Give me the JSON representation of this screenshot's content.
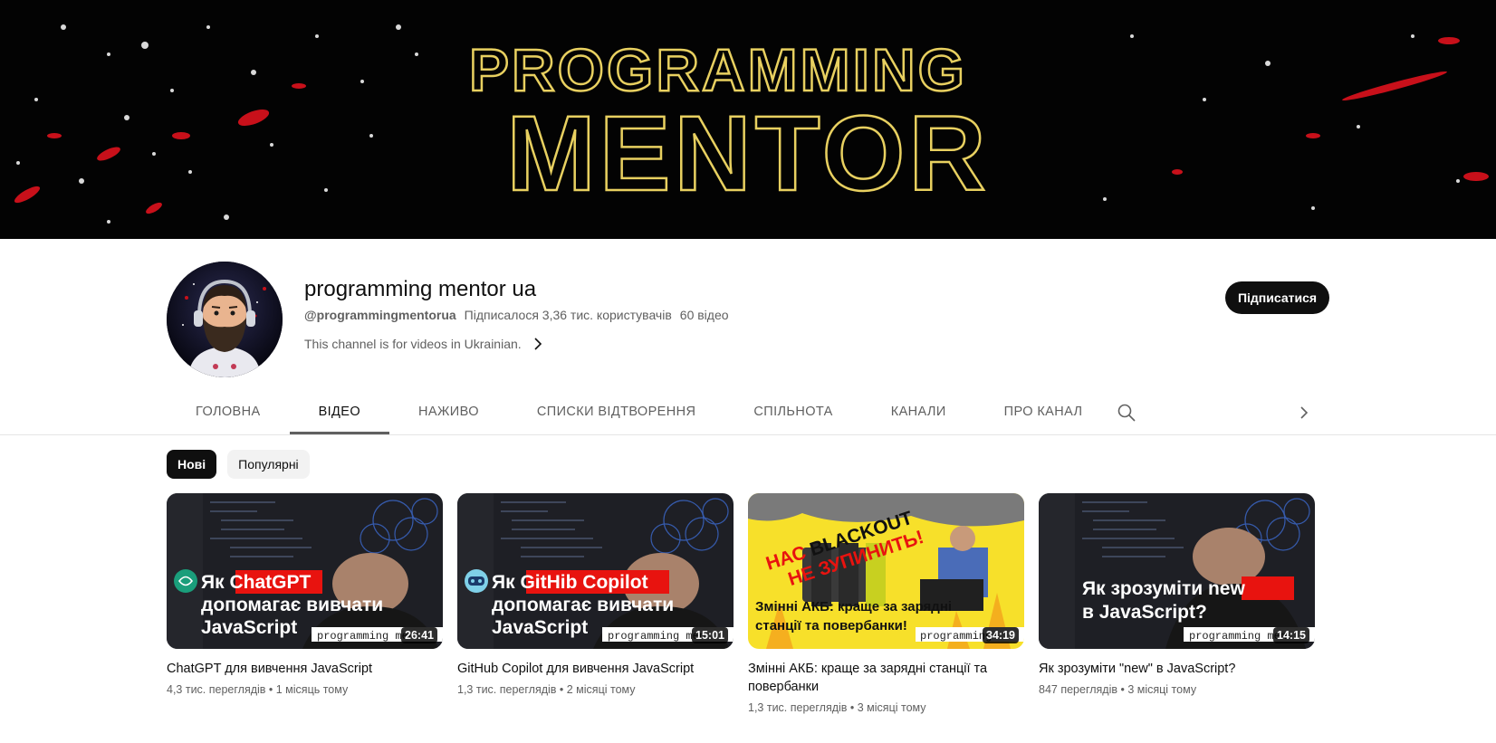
{
  "banner": {
    "line1": "PROGRAMMING",
    "line2": "MENTOR"
  },
  "channel": {
    "name": "programming mentor ua",
    "handle": "@programmingmentorua",
    "subscribers": "Підписалося 3,36 тис. користувачів",
    "video_count": "60 відео",
    "description": "This channel is for videos in Ukrainian.",
    "subscribe_label": "Підписатися"
  },
  "tabs": [
    {
      "label": "ГОЛОВНА"
    },
    {
      "label": "ВІДЕО"
    },
    {
      "label": "НАЖИВО"
    },
    {
      "label": "СПИСКИ ВІДТВОРЕННЯ"
    },
    {
      "label": "СПІЛЬНОТА"
    },
    {
      "label": "КАНАЛИ"
    },
    {
      "label": "ПРО КАНАЛ"
    }
  ],
  "active_tab": "ВІДЕО",
  "chips": [
    {
      "label": "Нові"
    },
    {
      "label": "Популярні"
    }
  ],
  "videos": [
    {
      "title": "ChatGPT для вивчення JavaScript",
      "meta": "4,3 тис. переглядів • 1 місяць тому",
      "duration": "26:41",
      "thumb_line1_a": "Як ",
      "thumb_line1_b": "ChatGPT",
      "thumb_line2": "допомагає вивчати",
      "thumb_line3": "JavaScript",
      "watermark": "programming men"
    },
    {
      "title": "GitHub Copilot для вивчення JavaScript",
      "meta": "1,3 тис. переглядів • 2 місяці тому",
      "duration": "15:01",
      "thumb_line1_a": "Як ",
      "thumb_line1_b": "GitHib Copilot",
      "thumb_line2": "допомагає вивчати",
      "thumb_line3": "JavaScript",
      "watermark": "programming men"
    },
    {
      "title": "Змінні АКБ: краще за зарядні станції та повербанки",
      "meta": "1,3 тис. переглядів • 3 місяці тому",
      "duration": "34:19",
      "thumb_line1_a": "НАС ",
      "thumb_line1_b": "BLACKOUT",
      "thumb_line2": "НЕ ЗУПИНИТЬ!",
      "thumb_line3": "Змінні АКБ: краще за зарядні",
      "thumb_line4": "станції та повербанки!",
      "watermark": "programming"
    },
    {
      "title": "Як зрозуміти \"new\" в JavaScript?",
      "meta": "847 переглядів • 3 місяці тому",
      "duration": "14:15",
      "thumb_line1_a": "Як зрозуміти ",
      "thumb_line1_b": "new",
      "thumb_line2": "в JavaScript?",
      "watermark": "programming men"
    }
  ],
  "colors": {
    "banner_gold": "#e8d060",
    "banner_red": "#c8101a",
    "accent_red": "#e8130f",
    "thumb_yellow": "#f7e02a"
  },
  "icons": [
    "search-icon",
    "chevron-right-icon",
    "chatgpt-icon",
    "copilot-icon"
  ]
}
